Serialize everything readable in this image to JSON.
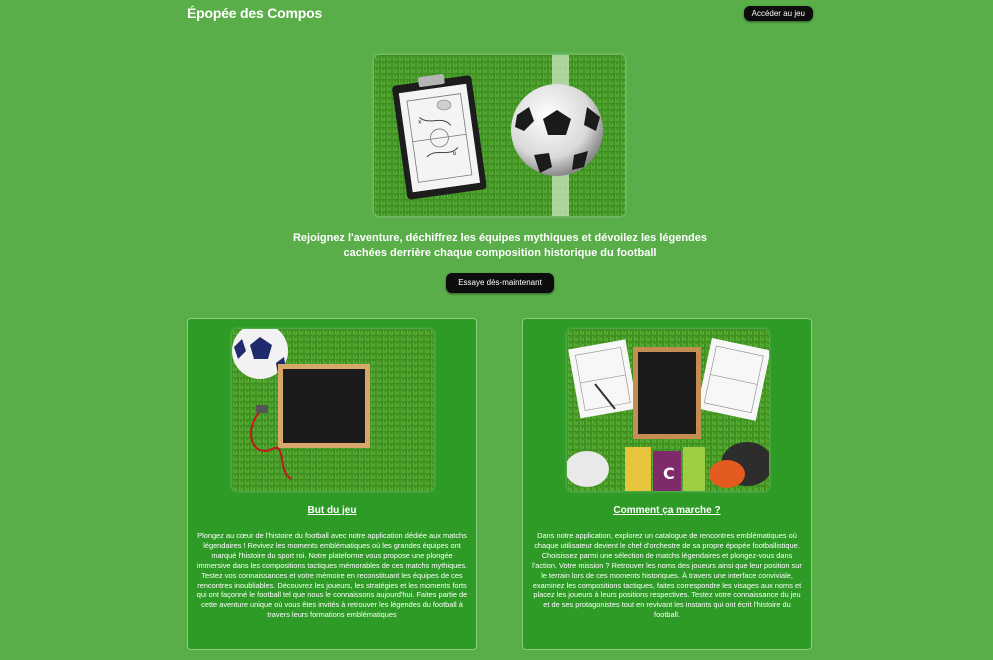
{
  "header": {
    "brand": "Épopée des Compos",
    "access_button": "Accéder au jeu"
  },
  "hero": {
    "tagline": "Rejoignez l'aventure, déchiffrez les équipes mythiques et dévoilez les légendes cachées derrière chaque composition historique du football",
    "cta_button": "Essaye dès-maintenant"
  },
  "cards": [
    {
      "title": "But du jeu",
      "text": "Plongez au cœur de l'histoire du football avec notre application dédiée aux matchs légendaires ! Revivez les moments emblématiques où les grandes équipes ont marqué l'histoire du sport roi. Notre plateforme vous propose une plongée immersive dans les compositions tactiques mémorables de ces matchs mythiques. Testez vos connaissances et votre mémoire en reconstituant les équipes de ces rencontres inoubliables. Découvrez les joueurs, les stratégies et les moments forts qui ont façonné le football tel que nous le connaissons aujourd'hui. Faites partie de cette aventure unique où vous êtes invités à retrouver les légendes du football à travers leurs formations emblématiques"
    },
    {
      "title": "Comment ça marche ?",
      "text": "Dans notre application, explorez un catalogue de rencontres emblématiques où chaque utilisateur devient le chef d'orchestre de sa propre épopée footballistique. Choisissez parmi une sélection de matchs légendaires et plongez-vous dans l'action. Votre mission ? Retrouver les noms des joueurs ainsi que leur position sur le terrain lors de ces moments historiques. À travers une interface conviviale, examinez les compositions tactiques, faites correspondre les visages aux noms et placez les joueurs à leurs positions respectives. Testez votre connaissance du jeu et de ses protagonistes tout en revivant les instants qui ont écrit l'histoire du football."
    }
  ],
  "colors": {
    "background": "#5aae4a",
    "card": "#2e9b26",
    "button": "#0d0d0d",
    "grass": "#3f8f22"
  }
}
